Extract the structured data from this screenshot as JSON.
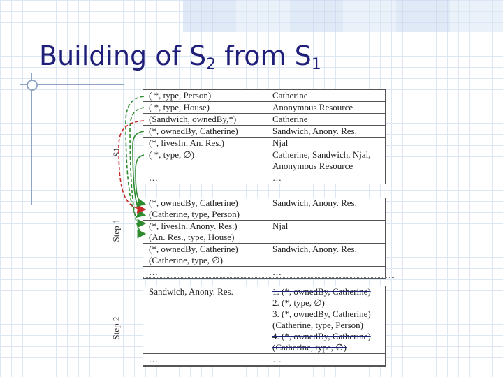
{
  "slide": {
    "title_main": "Building of S",
    "title_sub1": "2",
    "title_mid": " from S",
    "title_sub2": "1"
  },
  "labels": {
    "s1": "S1",
    "step1": "Step 1",
    "step2": "Step 2"
  },
  "s1_table": {
    "rows": [
      {
        "left": [
          "( *, type, Person)"
        ],
        "right": [
          "Catherine"
        ]
      },
      {
        "left": [
          "( *, type, House)"
        ],
        "right": [
          "Anonymous Resource"
        ]
      },
      {
        "left": [
          "(Sandwich, ownedBy,*)"
        ],
        "right": [
          "Catherine"
        ]
      },
      {
        "left": [
          "(*, ownedBy, Catherine)"
        ],
        "right": [
          "Sandwich, Anony. Res."
        ]
      },
      {
        "left": [
          "(*, livesIn, An. Res.)"
        ],
        "right": [
          "Njal"
        ]
      },
      {
        "left": [
          "( *, type, ∅)"
        ],
        "right": [
          "Catherine, Sandwich, Njal,",
          "Anonymous Resource"
        ]
      },
      {
        "left": [
          "…"
        ],
        "right": [
          "…"
        ]
      }
    ]
  },
  "step1_table": {
    "rows": [
      {
        "left": [
          "(*, ownedBy, Catherine)",
          "(Catherine, type, Person)"
        ],
        "right": [
          "Sandwich, Anony. Res."
        ]
      },
      {
        "left": [
          "(*, livesIn, Anony. Res.)",
          "(An. Res., type, House)"
        ],
        "right": [
          "Njal"
        ]
      },
      {
        "left": [
          "(*, ownedBy, Catherine)",
          "(Catherine, type, ∅)"
        ],
        "right": [
          "Sandwich, Anony. Res."
        ]
      },
      {
        "left": [
          "…"
        ],
        "right": [
          "…"
        ]
      }
    ]
  },
  "step2_table": {
    "rows": [
      {
        "left": [
          "Sandwich, Anony. Res."
        ],
        "right": [
          "1. (*, ownedBy, Catherine)",
          "2. (*, type, ∅)",
          "3. (*, ownedBy, Catherine)",
          "(Catherine, type, Person)",
          "4. (*, ownedBy, Catherine)",
          "(Catherine, type, ∅)"
        ],
        "struck": [
          0,
          4,
          5
        ]
      },
      {
        "left": [
          "…"
        ],
        "right": [
          "…"
        ]
      }
    ]
  },
  "colors": {
    "title": "#1f1f7a",
    "arrow_green": "#2e8b2e",
    "arrow_red": "#c62828",
    "strike": "#1a237e"
  }
}
